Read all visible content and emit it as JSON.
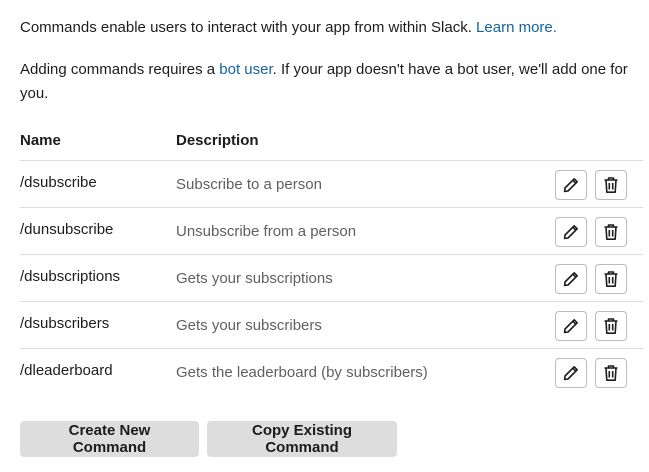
{
  "intro": {
    "line1_text": "Commands enable users to interact with your app from within Slack. ",
    "line1_link": "Learn more.",
    "line2_text_before": "Adding commands requires a ",
    "line2_link": "bot user",
    "line2_text_after": ". If your app doesn't have a bot user, we'll add one for you."
  },
  "table": {
    "headers": {
      "name": "Name",
      "description": "Description"
    },
    "rows": [
      {
        "name": "/dsubscribe",
        "description": "Subscribe to a person"
      },
      {
        "name": "/dunsubscribe",
        "description": "Unsubscribe from a person"
      },
      {
        "name": "/dsubscriptions",
        "description": "Gets your subscriptions"
      },
      {
        "name": "/dsubscribers",
        "description": "Gets your subscribers"
      },
      {
        "name": "/dleaderboard",
        "description": "Gets the leaderboard (by subscribers)"
      }
    ],
    "row_actions": {
      "edit_icon": "pencil-icon",
      "delete_icon": "trash-icon"
    }
  },
  "actions": {
    "create_label": "Create New Command",
    "copy_label": "Copy Existing Command"
  },
  "colors": {
    "link": "#1264a3",
    "text": "#1d1c1d",
    "muted": "#616061",
    "button_bg": "#dddddd",
    "divider": "#dddddd"
  }
}
